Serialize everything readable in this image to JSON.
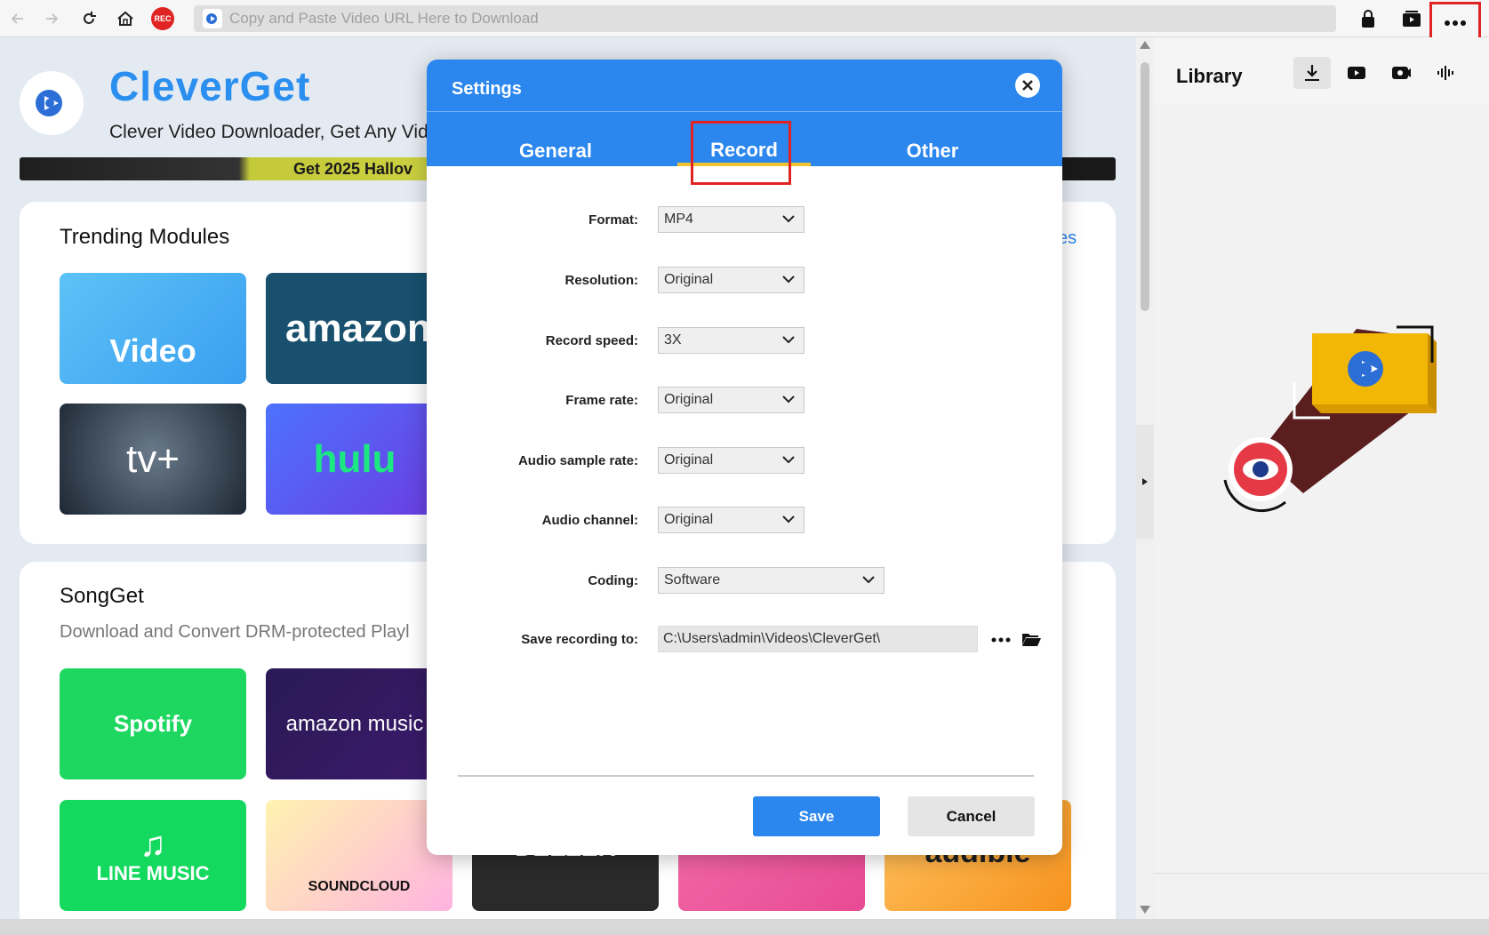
{
  "toolbar": {
    "url_placeholder": "Copy and Paste Video URL Here to Download",
    "rec_label": "REC"
  },
  "brand": {
    "title": "CleverGet",
    "subtitle": "Clever Video Downloader, Get Any Vid",
    "promo": "Get 2025 Hallov"
  },
  "trending": {
    "title": "Trending Modules",
    "more_link": "es",
    "tiles": [
      "Video",
      "amazon",
      "tv+",
      "hulu"
    ]
  },
  "songget": {
    "title": "SongGet",
    "description": "Download and Convert DRM-protected Playl",
    "tiles": [
      "Spotify",
      "amazon music",
      "LINE MUSIC",
      "SOUNDCLOUD",
      "DEEZER",
      "",
      "audible"
    ]
  },
  "library": {
    "title": "Library"
  },
  "settings": {
    "title": "Settings",
    "tabs": [
      "General",
      "Record",
      "Other"
    ],
    "active_tab": "Record",
    "fields": {
      "format": {
        "label": "Format:",
        "value": "MP4"
      },
      "resolution": {
        "label": "Resolution:",
        "value": "Original"
      },
      "record_speed": {
        "label": "Record speed:",
        "value": "3X"
      },
      "frame_rate": {
        "label": "Frame rate:",
        "value": "Original"
      },
      "audio_sample_rate": {
        "label": "Audio sample rate:",
        "value": "Original"
      },
      "audio_channel": {
        "label": "Audio channel:",
        "value": "Original"
      },
      "coding": {
        "label": "Coding:",
        "value": "Software"
      },
      "save_to": {
        "label": "Save recording to:",
        "value": "C:\\Users\\admin\\Videos\\CleverGet\\"
      }
    },
    "save_label": "Save",
    "cancel_label": "Cancel"
  },
  "colors": {
    "accent": "#2b86ee",
    "highlight": "#e02424",
    "tab_underline": "#f1c232"
  }
}
